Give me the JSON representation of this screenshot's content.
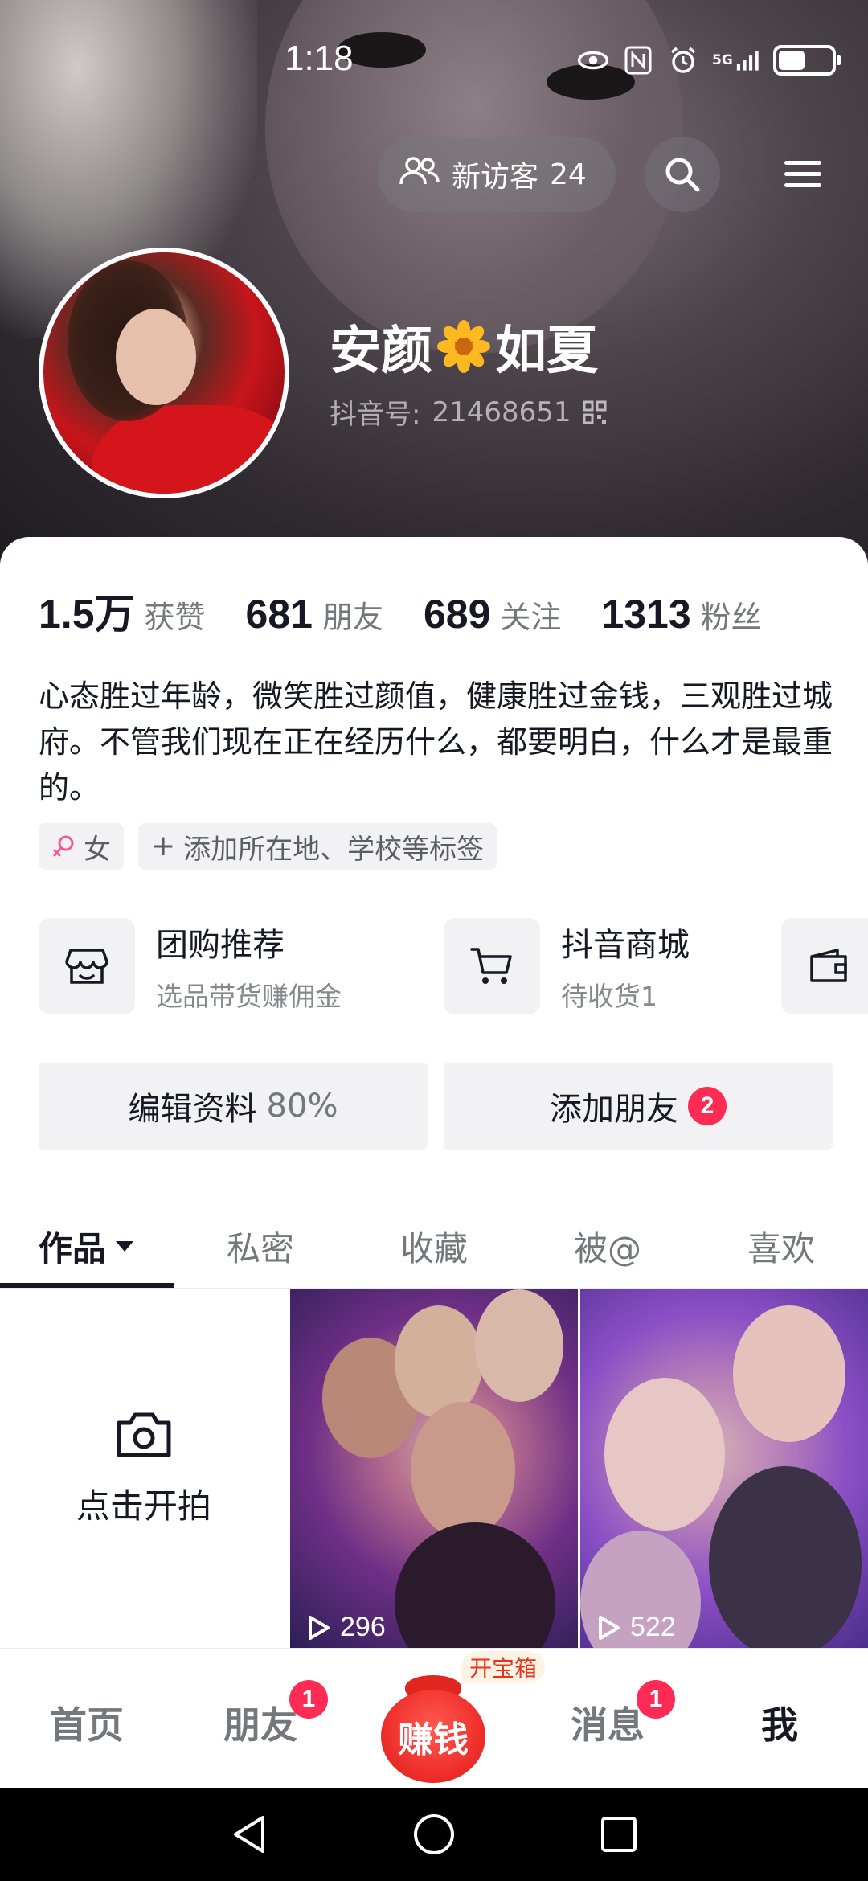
{
  "status_bar": {
    "time": "1:18",
    "network": "5G"
  },
  "header": {
    "visitors_label": "新访客",
    "visitors_count": "24"
  },
  "profile": {
    "name_left": "安颜",
    "name_right": "如夏",
    "name_emoji": "sunflower",
    "douyin_id_label": "抖音号:",
    "douyin_id": "21468651"
  },
  "stats": [
    {
      "num": "1.5万",
      "label": "获赞"
    },
    {
      "num": "681",
      "label": "朋友"
    },
    {
      "num": "689",
      "label": "关注"
    },
    {
      "num": "1313",
      "label": "粉丝"
    }
  ],
  "bio": "心态胜过年龄，微笑胜过颜值，健康胜过金钱，三观胜过城府。不管我们现在正在经历什么，都要明白，什么才是最重的。",
  "tags": {
    "gender": "女",
    "add_tag": "添加所在地、学校等标签"
  },
  "services": [
    {
      "title": "团购推荐",
      "subtitle": "选品带货赚佣金",
      "icon": "store-icon"
    },
    {
      "title": "抖音商城",
      "subtitle": "待收货1",
      "icon": "cart-icon"
    },
    {
      "title": "",
      "subtitle": "",
      "icon": "wallet-icon"
    }
  ],
  "actions": {
    "edit_label": "编辑资料",
    "edit_percent": "80%",
    "add_friend_label": "添加朋友",
    "add_friend_badge": "2"
  },
  "tabs": [
    "作品",
    "私密",
    "收藏",
    "被@",
    "喜欢"
  ],
  "grid": {
    "shoot_label": "点击开拍",
    "videos": [
      {
        "plays": "296"
      },
      {
        "plays": "522"
      }
    ]
  },
  "bottom_nav": {
    "home": "首页",
    "friends": "朋友",
    "friends_badge": "1",
    "earn": "赚钱",
    "treasure": "开宝箱",
    "messages": "消息",
    "messages_badge": "1",
    "me": "我"
  },
  "colors": {
    "accent": "#fe2c55",
    "text_primary": "#161823",
    "text_secondary": "#75777c"
  }
}
